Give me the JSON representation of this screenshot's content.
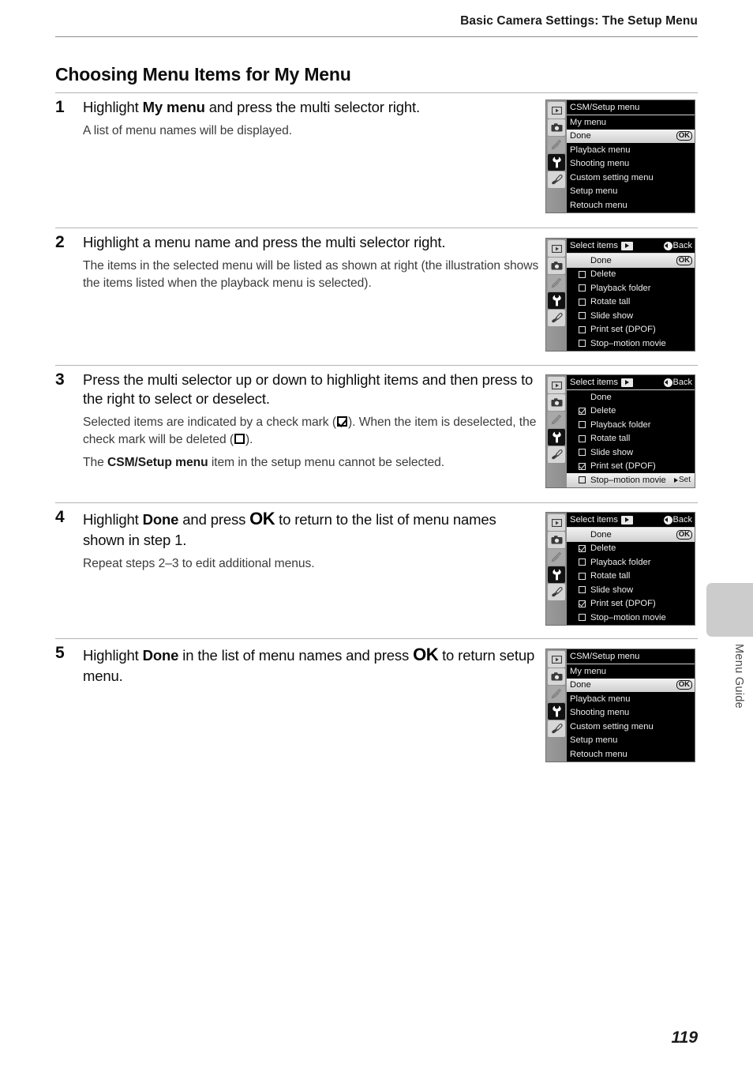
{
  "header": {
    "running_title": "Basic Camera Settings: The Setup Menu"
  },
  "section": {
    "title": "Choosing Menu Items for My Menu"
  },
  "steps": [
    {
      "number": "1",
      "head_pre": "Highlight ",
      "head_bold": "My menu",
      "head_post": " and press the multi selector right.",
      "para": "A list of menu names will be displayed."
    },
    {
      "number": "2",
      "head_pre": "Highlight a menu name and press the multi selector right.",
      "head_bold": "",
      "head_post": "",
      "para": "The items in the selected menu will be listed as shown at right (the illustration shows the items listed when the playback menu is selected)."
    },
    {
      "number": "3",
      "head_pre": "Press the multi selector up or down to highlight items and then press to the right to select or deselect.",
      "head_bold": "",
      "head_post": "",
      "para_a_1": "Selected items are indicated by a check mark (",
      "para_a_2": "). When the item is deselected, the check mark will be deleted (",
      "para_a_3": ").",
      "para_b_1": "The ",
      "para_b_bold": "CSM/Setup menu",
      "para_b_2": " item in the setup menu cannot be selected."
    },
    {
      "number": "4",
      "head_pre": "Highlight ",
      "head_bold": "Done",
      "head_mid": " and press ",
      "head_ok": "OK",
      "head_post": " to return to the list of menu names shown in step 1.",
      "para": "Repeat steps 2–3 to edit additional menus."
    },
    {
      "number": "5",
      "head_pre": "Highlight ",
      "head_bold": "Done",
      "head_mid": " in the list of menu names and press ",
      "head_ok": "OK",
      "head_post": " to return setup menu."
    }
  ],
  "lcd_tabs": [
    {
      "name": "playback-tab-icon",
      "state": "normal"
    },
    {
      "name": "shooting-tab-icon",
      "state": "normal"
    },
    {
      "name": "custom-setting-tab-icon",
      "state": "dim"
    },
    {
      "name": "setup-tab-icon",
      "state": "active"
    },
    {
      "name": "retouch-tab-icon",
      "state": "normal"
    }
  ],
  "screens": {
    "step1": {
      "title": "CSM/Setup menu",
      "title_icon": "none",
      "back_label": "",
      "rows": [
        {
          "label": "My menu",
          "checkbox": "none",
          "selected": false,
          "badge": ""
        },
        {
          "label": "Done",
          "checkbox": "none",
          "selected": true,
          "badge": "OK"
        },
        {
          "label": "Playback menu",
          "checkbox": "none",
          "selected": false,
          "badge": ""
        },
        {
          "label": "Shooting menu",
          "checkbox": "none",
          "selected": false,
          "badge": ""
        },
        {
          "label": "Custom setting menu",
          "checkbox": "none",
          "selected": false,
          "badge": ""
        },
        {
          "label": "Setup menu",
          "checkbox": "none",
          "selected": false,
          "badge": ""
        },
        {
          "label": "Retouch menu",
          "checkbox": "none",
          "selected": false,
          "badge": ""
        }
      ]
    },
    "step2": {
      "title": "Select items",
      "title_icon": "playback",
      "back_label": "Back",
      "rows": [
        {
          "label": "Done",
          "checkbox": "none",
          "selected": true,
          "badge": "OK"
        },
        {
          "label": "Delete",
          "checkbox": "empty",
          "selected": false,
          "badge": ""
        },
        {
          "label": "Playback folder",
          "checkbox": "empty",
          "selected": false,
          "badge": ""
        },
        {
          "label": "Rotate tall",
          "checkbox": "empty",
          "selected": false,
          "badge": ""
        },
        {
          "label": "Slide show",
          "checkbox": "empty",
          "selected": false,
          "badge": ""
        },
        {
          "label": "Print set (DPOF)",
          "checkbox": "empty",
          "selected": false,
          "badge": ""
        },
        {
          "label": "Stop–motion movie",
          "checkbox": "empty",
          "selected": false,
          "badge": ""
        }
      ]
    },
    "step3": {
      "title": "Select items",
      "title_icon": "playback",
      "back_label": "Back",
      "rows": [
        {
          "label": "Done",
          "checkbox": "none",
          "selected": false,
          "badge": ""
        },
        {
          "label": "Delete",
          "checkbox": "checked",
          "selected": false,
          "badge": ""
        },
        {
          "label": "Playback folder",
          "checkbox": "empty",
          "selected": false,
          "badge": ""
        },
        {
          "label": "Rotate tall",
          "checkbox": "empty",
          "selected": false,
          "badge": ""
        },
        {
          "label": "Slide show",
          "checkbox": "empty",
          "selected": false,
          "badge": ""
        },
        {
          "label": "Print set (DPOF)",
          "checkbox": "checked",
          "selected": false,
          "badge": ""
        },
        {
          "label": "Stop–motion movie",
          "checkbox": "empty",
          "selected": true,
          "badge": "Set"
        }
      ]
    },
    "step4": {
      "title": "Select items",
      "title_icon": "playback",
      "back_label": "Back",
      "rows": [
        {
          "label": "Done",
          "checkbox": "none",
          "selected": true,
          "badge": "OK"
        },
        {
          "label": "Delete",
          "checkbox": "checked",
          "selected": false,
          "badge": ""
        },
        {
          "label": "Playback folder",
          "checkbox": "empty",
          "selected": false,
          "badge": ""
        },
        {
          "label": "Rotate tall",
          "checkbox": "empty",
          "selected": false,
          "badge": ""
        },
        {
          "label": "Slide show",
          "checkbox": "empty",
          "selected": false,
          "badge": ""
        },
        {
          "label": "Print set (DPOF)",
          "checkbox": "checked",
          "selected": false,
          "badge": ""
        },
        {
          "label": "Stop–motion movie",
          "checkbox": "empty",
          "selected": false,
          "badge": ""
        }
      ]
    },
    "step5": {
      "title": "CSM/Setup menu",
      "title_icon": "none",
      "back_label": "",
      "rows": [
        {
          "label": "My menu",
          "checkbox": "none",
          "selected": false,
          "badge": ""
        },
        {
          "label": "Done",
          "checkbox": "none",
          "selected": true,
          "badge": "OK"
        },
        {
          "label": "Playback menu",
          "checkbox": "none",
          "selected": false,
          "badge": ""
        },
        {
          "label": "Shooting menu",
          "checkbox": "none",
          "selected": false,
          "badge": ""
        },
        {
          "label": "Custom setting menu",
          "checkbox": "none",
          "selected": false,
          "badge": ""
        },
        {
          "label": "Setup menu",
          "checkbox": "none",
          "selected": false,
          "badge": ""
        },
        {
          "label": "Retouch menu",
          "checkbox": "none",
          "selected": false,
          "badge": ""
        }
      ]
    }
  },
  "side_tab": {
    "label": "Menu Guide"
  },
  "footer": {
    "page_number": "119"
  }
}
